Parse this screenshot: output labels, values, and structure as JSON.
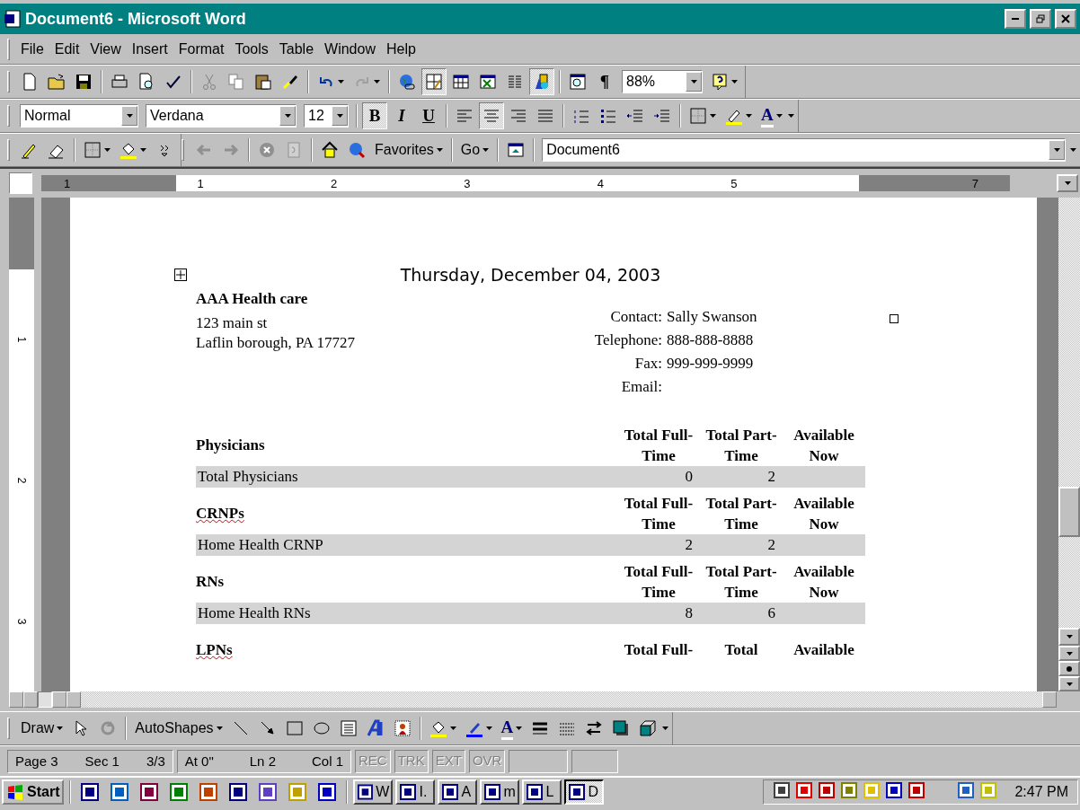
{
  "window": {
    "title": "Document6 - Microsoft Word"
  },
  "menu": [
    "File",
    "Edit",
    "View",
    "Insert",
    "Format",
    "Tools",
    "Table",
    "Window",
    "Help"
  ],
  "standard_toolbar": {
    "toggles": [
      {
        "selected": true
      },
      {
        "selected": false
      },
      {
        "selected": false
      },
      {
        "selected": false
      },
      {
        "selected": true
      }
    ],
    "pilcrow": "¶",
    "zoom": "88%"
  },
  "formatting_toolbar": {
    "style": "Normal",
    "font": "Verdana",
    "size": "12",
    "font_buttons": [
      {
        "label": "B",
        "selected": true
      },
      {
        "label": "I",
        "selected": false
      },
      {
        "label": "U",
        "selected": false
      }
    ],
    "alignment": [
      {
        "selected": false
      },
      {
        "selected": true
      },
      {
        "selected": false
      },
      {
        "selected": false
      }
    ],
    "font_color_glyph": "A"
  },
  "web_toolbar": {
    "favorites": "Favorites",
    "go": "Go",
    "address": "Document6"
  },
  "ruler": {
    "horizontal": [
      "1",
      "1",
      "2",
      "3",
      "4",
      "5",
      "7"
    ],
    "vertical": [
      "1",
      "2",
      "3"
    ]
  },
  "document": {
    "date": "Thursday, December 04, 2003",
    "company": "AAA Health care",
    "address": [
      "123 main st",
      "Laflin borough, PA 17727"
    ],
    "contact": [
      {
        "label": "Contact:",
        "value": "Sally Swanson"
      },
      {
        "label": "Telephone:",
        "value": "888-888-8888"
      },
      {
        "label": "Fax:",
        "value": "999-999-9999"
      },
      {
        "label": "Email:"
      }
    ],
    "sections": [
      {
        "heading": "Physicians",
        "spelling_error": false,
        "columns": [
          "Total Full-Time",
          "Total Part-Time",
          "Available Now"
        ],
        "rows": [
          {
            "name": "Total Physicians",
            "values": [
              "0",
              "2"
            ]
          }
        ]
      },
      {
        "heading": "CRNPs",
        "spelling_error": true,
        "columns": [
          "Total Full-Time",
          "Total Part-Time",
          "Available Now"
        ],
        "rows": [
          {
            "name": "Home Health CRNP",
            "values": [
              "2",
              "2"
            ]
          }
        ]
      },
      {
        "heading": "RNs",
        "spelling_error": false,
        "columns": [
          "Total Full-Time",
          "Total Part-Time",
          "Available Now"
        ],
        "rows": [
          {
            "name": "Home Health RNs",
            "values": [
              "8",
              "6"
            ]
          }
        ]
      },
      {
        "heading": "LPNs",
        "spelling_error": true,
        "columns": [
          "Total Full-",
          "Total",
          "Available"
        ]
      }
    ]
  },
  "view_buttons": [
    {
      "selected": false
    },
    {
      "selected": false
    },
    {
      "selected": true
    },
    {
      "selected": false
    }
  ],
  "drawing_toolbar": {
    "draw": "Draw",
    "autoshapes": "AutoShapes",
    "font_color_glyph": "A"
  },
  "status_bar": {
    "fields": [
      "Page 3",
      "Sec 1",
      "3/3",
      "At 0\"",
      "Ln 2",
      "Col 1"
    ],
    "modes": [
      {
        "label": "REC",
        "on": false
      },
      {
        "label": "TRK",
        "on": false
      },
      {
        "label": "EXT",
        "on": false
      },
      {
        "label": "OVR",
        "on": false
      }
    ]
  },
  "taskbar": {
    "start": "Start",
    "tasks": [
      {
        "label": "W",
        "selected": false
      },
      {
        "label": "I.",
        "selected": false
      },
      {
        "label": "A",
        "selected": false
      },
      {
        "label": "m",
        "selected": false
      },
      {
        "label": "L",
        "selected": false
      },
      {
        "label": "D",
        "selected": true
      }
    ],
    "clock": "2:47 PM"
  }
}
